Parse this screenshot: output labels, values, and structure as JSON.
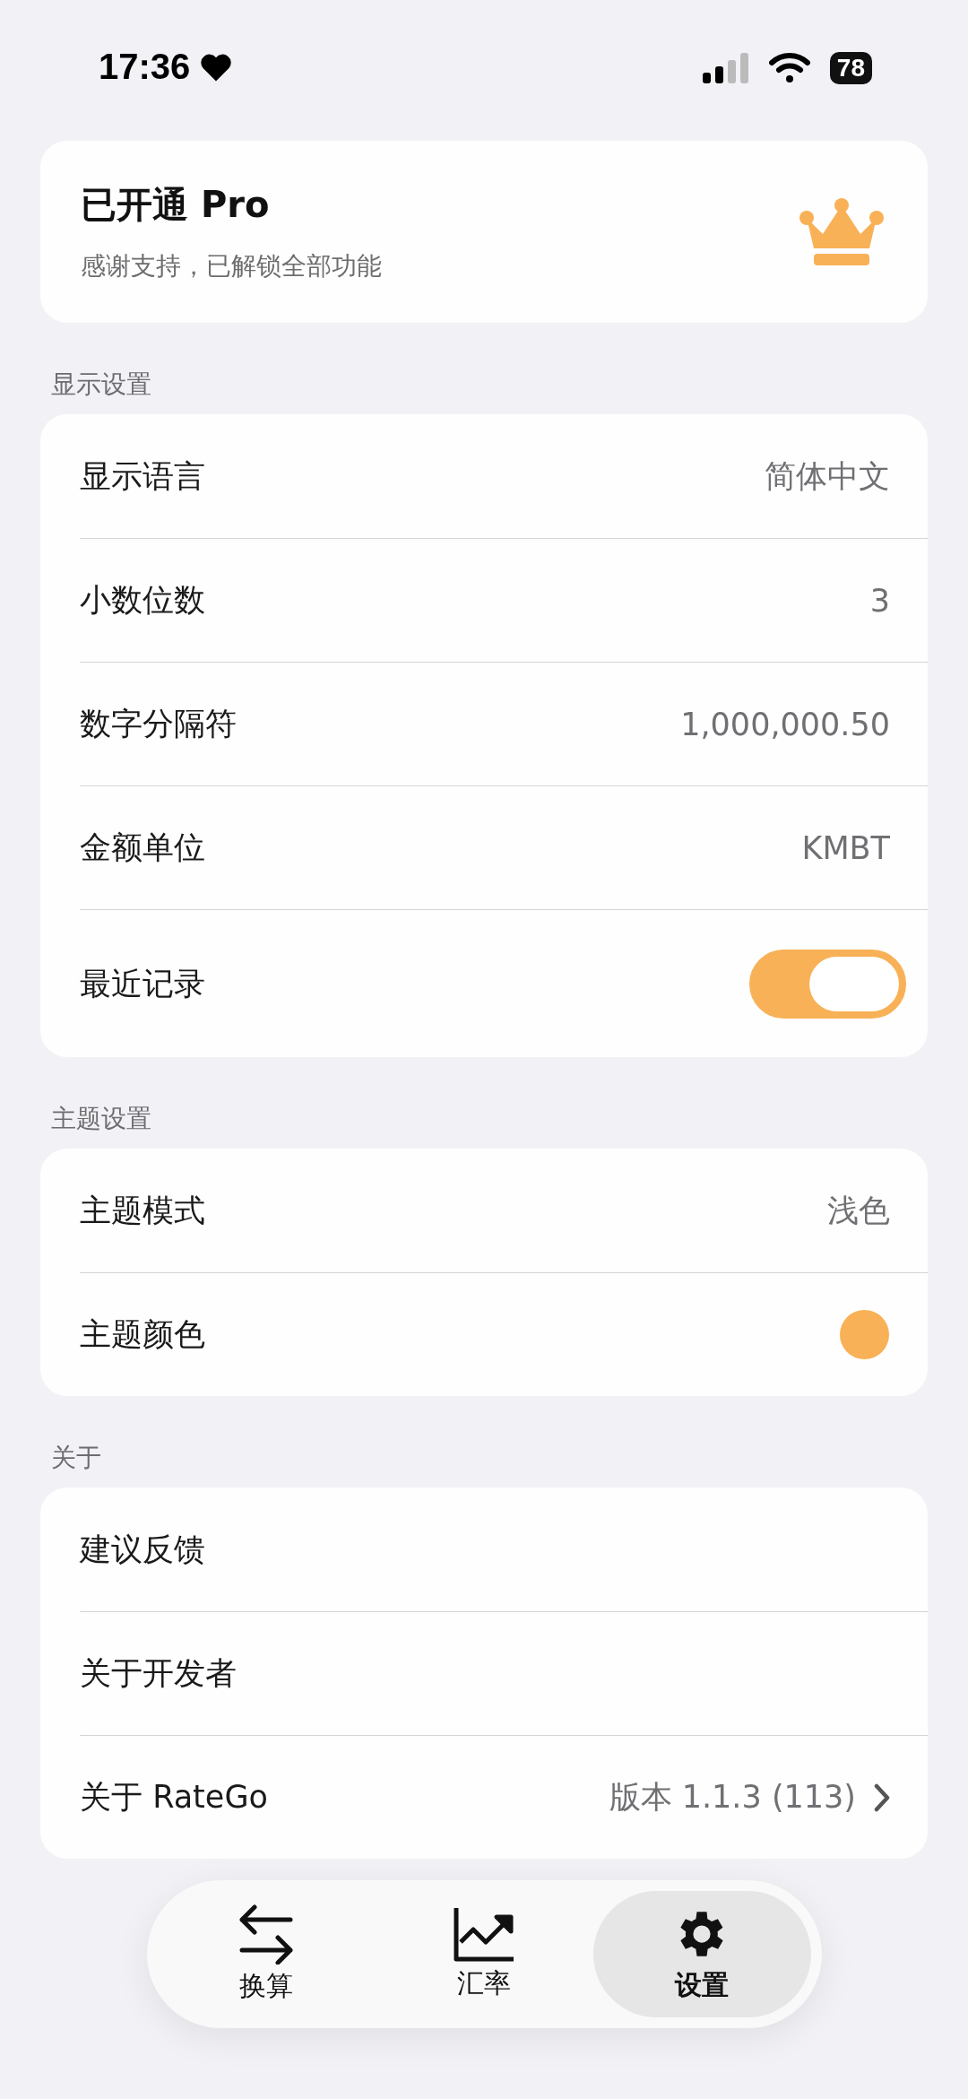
{
  "status_bar": {
    "time": "17:36",
    "battery": "78"
  },
  "pro_card": {
    "title": "已开通 Pro",
    "subtitle": "感谢支持，已解锁全部功能"
  },
  "sections": [
    {
      "header": "显示设置",
      "rows": [
        {
          "kind": "value",
          "label": "显示语言",
          "value": "简体中文"
        },
        {
          "kind": "value",
          "label": "小数位数",
          "value": "3"
        },
        {
          "kind": "value",
          "label": "数字分隔符",
          "value": "1,000,000.50"
        },
        {
          "kind": "value",
          "label": "金额单位",
          "value": "KMBT"
        },
        {
          "kind": "toggle",
          "label": "最近记录",
          "on": true
        }
      ]
    },
    {
      "header": "主题设置",
      "rows": [
        {
          "kind": "value",
          "label": "主题模式",
          "value": "浅色"
        },
        {
          "kind": "color",
          "label": "主题颜色",
          "color": "#f8b156"
        }
      ]
    },
    {
      "header": "关于",
      "rows": [
        {
          "kind": "value",
          "label": "建议反馈"
        },
        {
          "kind": "value",
          "label": "关于开发者"
        },
        {
          "kind": "link",
          "label": "关于 RateGo",
          "value": "版本 1.1.3 (113)"
        }
      ]
    }
  ],
  "tabs": [
    {
      "kind": "convert",
      "label": "换算",
      "selected": false
    },
    {
      "kind": "chart",
      "label": "汇率",
      "selected": false
    },
    {
      "kind": "settings",
      "label": "设置",
      "selected": true
    }
  ]
}
